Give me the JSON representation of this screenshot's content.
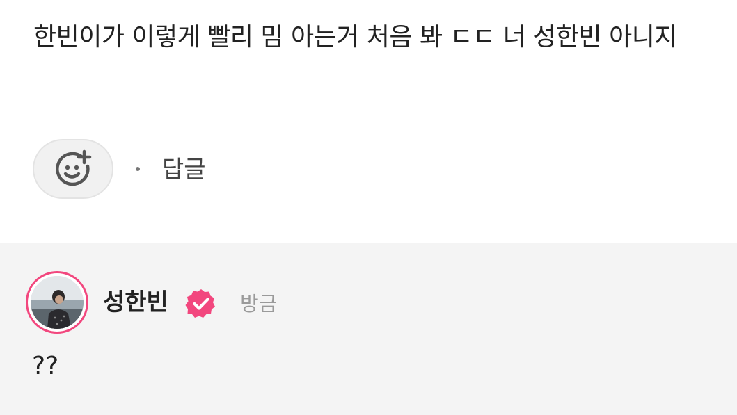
{
  "comment": {
    "text": "한빈이가 이렇게 빨리 밈 아는거 처음 봐 ㄷㄷ 너 성한빈 아니지",
    "add_reaction_icon": "smiley-plus-icon",
    "separator": "·",
    "reply_label": "답글"
  },
  "reply": {
    "author": "성한빈",
    "verified_icon": "verified-badge-icon",
    "time": "방금",
    "text": "??",
    "accent_color": "#f2477e"
  }
}
